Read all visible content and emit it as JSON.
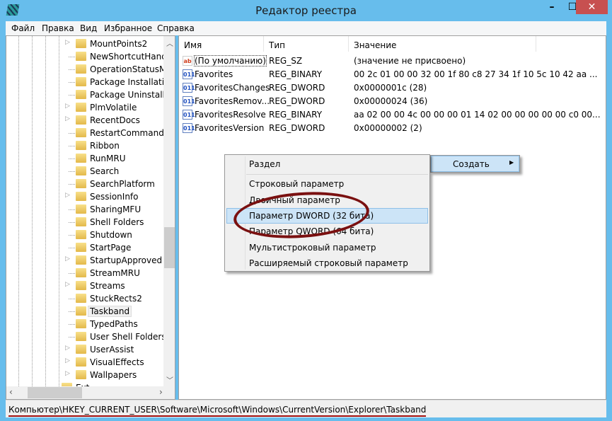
{
  "window": {
    "title": "Редактор реестра",
    "minimize": "–",
    "maximize": "☐",
    "close": "✕",
    "close_color": "#c75050",
    "accent": "#67bdec"
  },
  "menu": [
    "Файл",
    "Правка",
    "Вид",
    "Избранное",
    "Справка"
  ],
  "tree": {
    "items": [
      {
        "label": "MountPoints2",
        "expandable": true
      },
      {
        "label": "NewShortcutHandle",
        "expandable": false
      },
      {
        "label": "OperationStatusMa",
        "expandable": false
      },
      {
        "label": "Package Installation",
        "expandable": false
      },
      {
        "label": "Package Uninstallat",
        "expandable": false
      },
      {
        "label": "PlmVolatile",
        "expandable": true
      },
      {
        "label": "RecentDocs",
        "expandable": true
      },
      {
        "label": "RestartCommands",
        "expandable": false
      },
      {
        "label": "Ribbon",
        "expandable": false
      },
      {
        "label": "RunMRU",
        "expandable": false
      },
      {
        "label": "Search",
        "expandable": false
      },
      {
        "label": "SearchPlatform",
        "expandable": false
      },
      {
        "label": "SessionInfo",
        "expandable": true
      },
      {
        "label": "SharingMFU",
        "expandable": false
      },
      {
        "label": "Shell Folders",
        "expandable": false
      },
      {
        "label": "Shutdown",
        "expandable": false
      },
      {
        "label": "StartPage",
        "expandable": false
      },
      {
        "label": "StartupApproved",
        "expandable": true
      },
      {
        "label": "StreamMRU",
        "expandable": false
      },
      {
        "label": "Streams",
        "expandable": true
      },
      {
        "label": "StuckRects2",
        "expandable": false
      },
      {
        "label": "Taskband",
        "expandable": false,
        "selected": true
      },
      {
        "label": "TypedPaths",
        "expandable": false
      },
      {
        "label": "User Shell Folders",
        "expandable": false
      },
      {
        "label": "UserAssist",
        "expandable": true
      },
      {
        "label": "VisualEffects",
        "expandable": true
      },
      {
        "label": "Wallpapers",
        "expandable": true
      },
      {
        "label": "Ext",
        "expandable": false,
        "partial": true
      }
    ]
  },
  "list": {
    "columns": [
      "Имя",
      "Тип",
      "Значение"
    ],
    "rows": [
      {
        "icon": "string-value-icon",
        "name": "(По умолчанию)",
        "type": "REG_SZ",
        "value": "(значение не присвоено)"
      },
      {
        "icon": "binary-value-icon",
        "name": "Favorites",
        "type": "REG_BINARY",
        "value": "00 2c 01 00 00 32 00 1f 80 c8 27 34 1f 10 5c 10 42 aa ..."
      },
      {
        "icon": "binary-value-icon",
        "name": "FavoritesChanges",
        "type": "REG_DWORD",
        "value": "0x0000001c (28)"
      },
      {
        "icon": "binary-value-icon",
        "name": "FavoritesRemov...",
        "type": "REG_DWORD",
        "value": "0x00000024 (36)"
      },
      {
        "icon": "binary-value-icon",
        "name": "FavoritesResolve",
        "type": "REG_BINARY",
        "value": "aa 02 00 00 4c 00 00 00 01 14 02 00 00 00 00 00 c0 00..."
      },
      {
        "icon": "binary-value-icon",
        "name": "FavoritesVersion",
        "type": "REG_DWORD",
        "value": "0x00000002 (2)"
      }
    ]
  },
  "context_menu": {
    "parent": "Создать",
    "items": [
      "Раздел",
      "Строковый параметр",
      "Двоичный параметр",
      "Параметр DWORD (32 бита)",
      "Параметр QWORD (64 бита)",
      "Мультистроковый параметр",
      "Расширяемый строковый параметр"
    ],
    "highlighted": "Параметр DWORD (32 бита)",
    "highlight_color": "#cce4f7",
    "annotation_color": "#7a1010"
  },
  "status": {
    "path": "Компьютер\\HKEY_CURRENT_USER\\Software\\Microsoft\\Windows\\CurrentVersion\\Explorer\\Taskband"
  }
}
